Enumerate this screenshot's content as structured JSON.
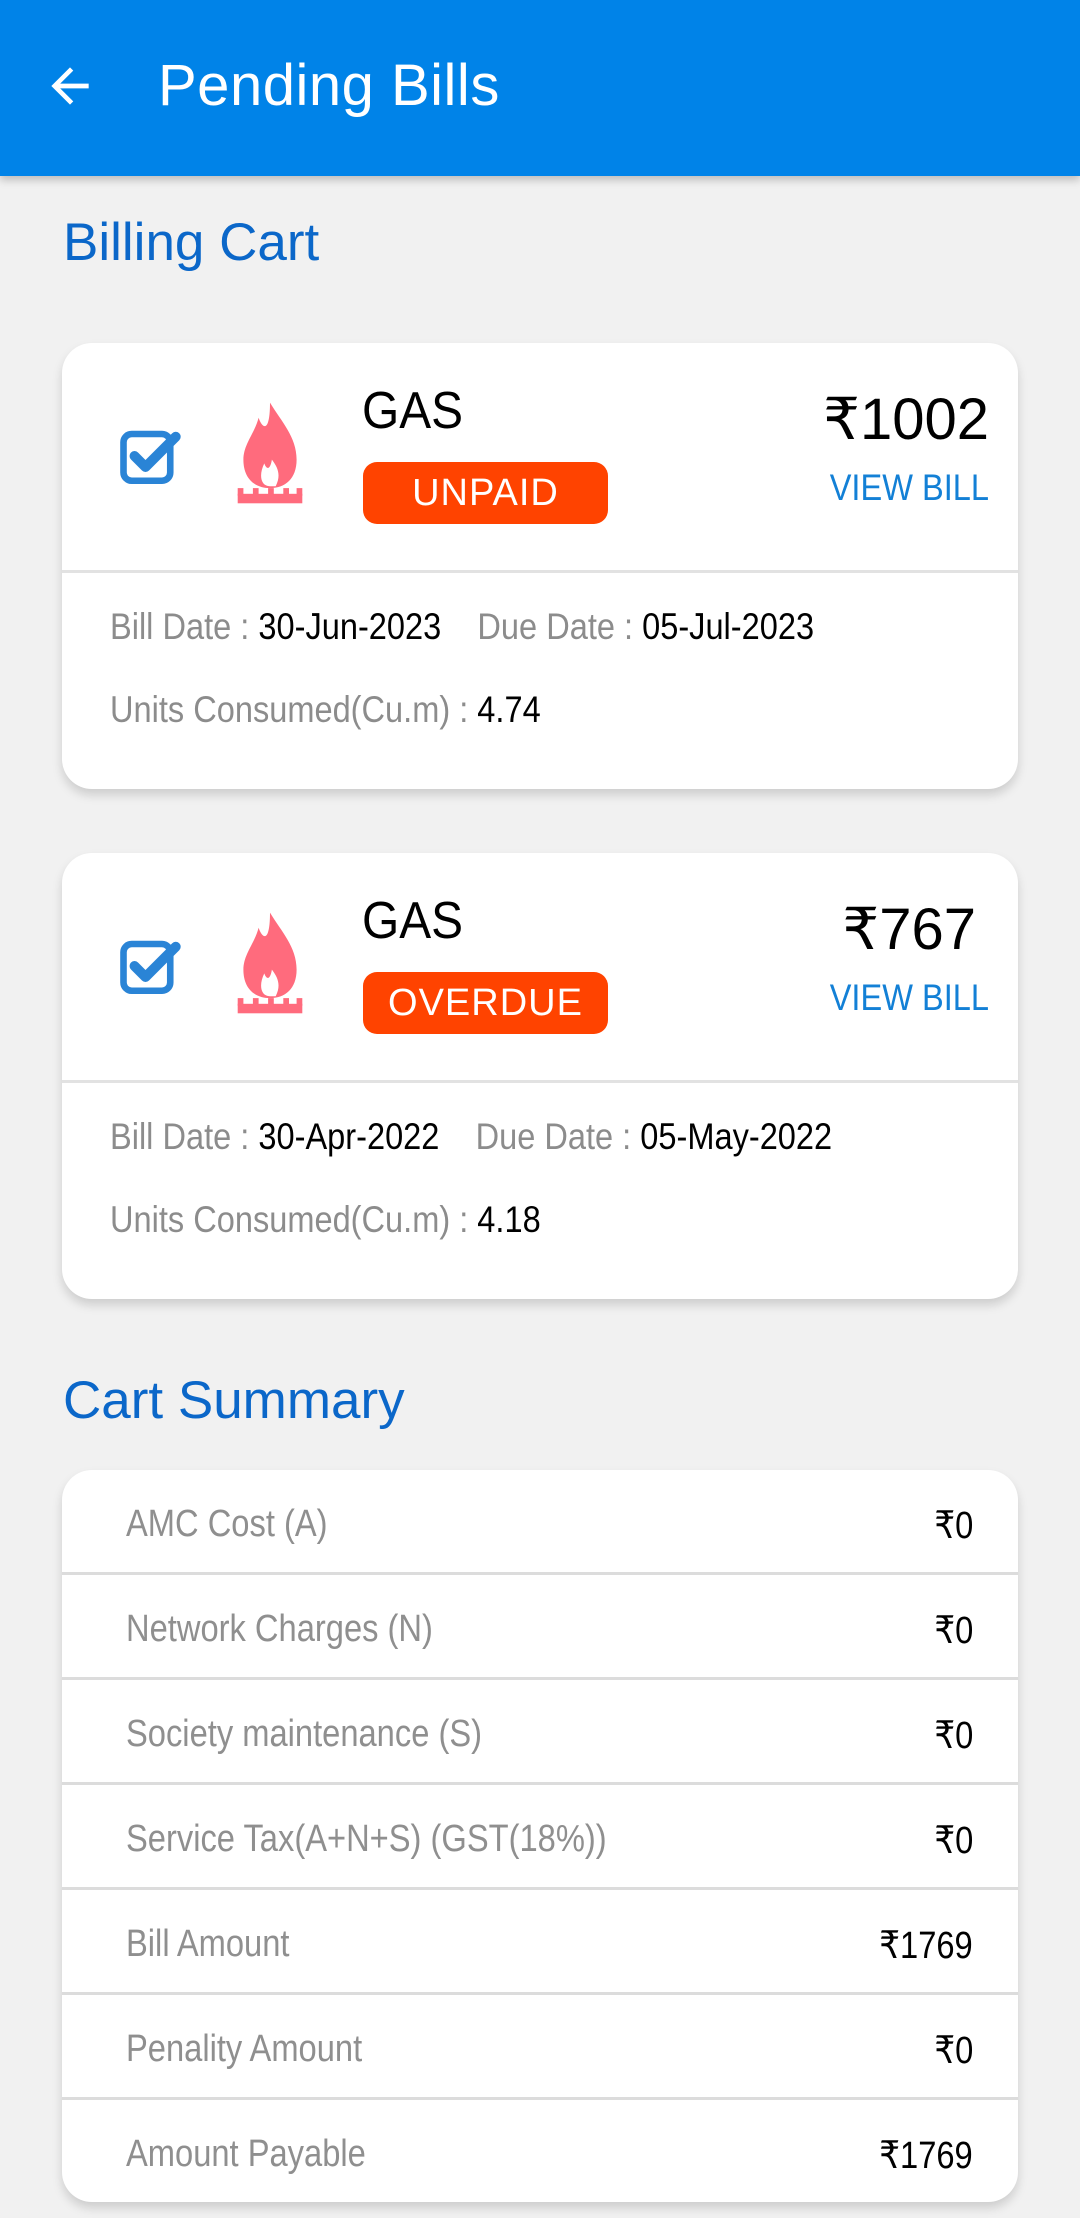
{
  "header": {
    "title": "Pending Bills",
    "back_icon": "arrow-left-icon",
    "bg_color": "#0083e8"
  },
  "billing_cart": {
    "title": "Billing Cart",
    "bills": [
      {
        "checked": true,
        "service": "GAS",
        "status": "UNPAID",
        "amount": "₹1002",
        "view_bill_label": "VIEW BILL",
        "bill_date_label": "Bill Date :",
        "bill_date": "30-Jun-2023",
        "due_date_label": "Due Date :",
        "due_date": "05-Jul-2023",
        "units_label": "Units Consumed(Cu.m) :",
        "units": "4.74"
      },
      {
        "checked": true,
        "service": "GAS",
        "status": "OVERDUE",
        "amount": "₹767",
        "view_bill_label": "VIEW BILL",
        "bill_date_label": "Bill Date :",
        "bill_date": "30-Apr-2022",
        "due_date_label": "Due Date :",
        "due_date": "05-May-2022",
        "units_label": "Units Consumed(Cu.m) :",
        "units": "4.18"
      }
    ]
  },
  "cart_summary": {
    "title": "Cart Summary",
    "rows": [
      {
        "label": "AMC Cost (A)",
        "value": "₹0"
      },
      {
        "label": "Network Charges (N)",
        "value": "₹0"
      },
      {
        "label": "Society maintenance (S)",
        "value": "₹0"
      },
      {
        "label": "Service Tax(A+N+S) (GST(18%))",
        "value": "₹0"
      },
      {
        "label": "Bill Amount",
        "value": "₹1769"
      },
      {
        "label": "Penality Amount",
        "value": "₹0"
      },
      {
        "label": "Amount Payable",
        "value": "₹1769"
      }
    ]
  },
  "colors": {
    "accent": "#0b67c9",
    "badge": "#ff4300",
    "link": "#1380d6",
    "flame": "#ff6b7d",
    "checkbox": "#2a84d6"
  }
}
